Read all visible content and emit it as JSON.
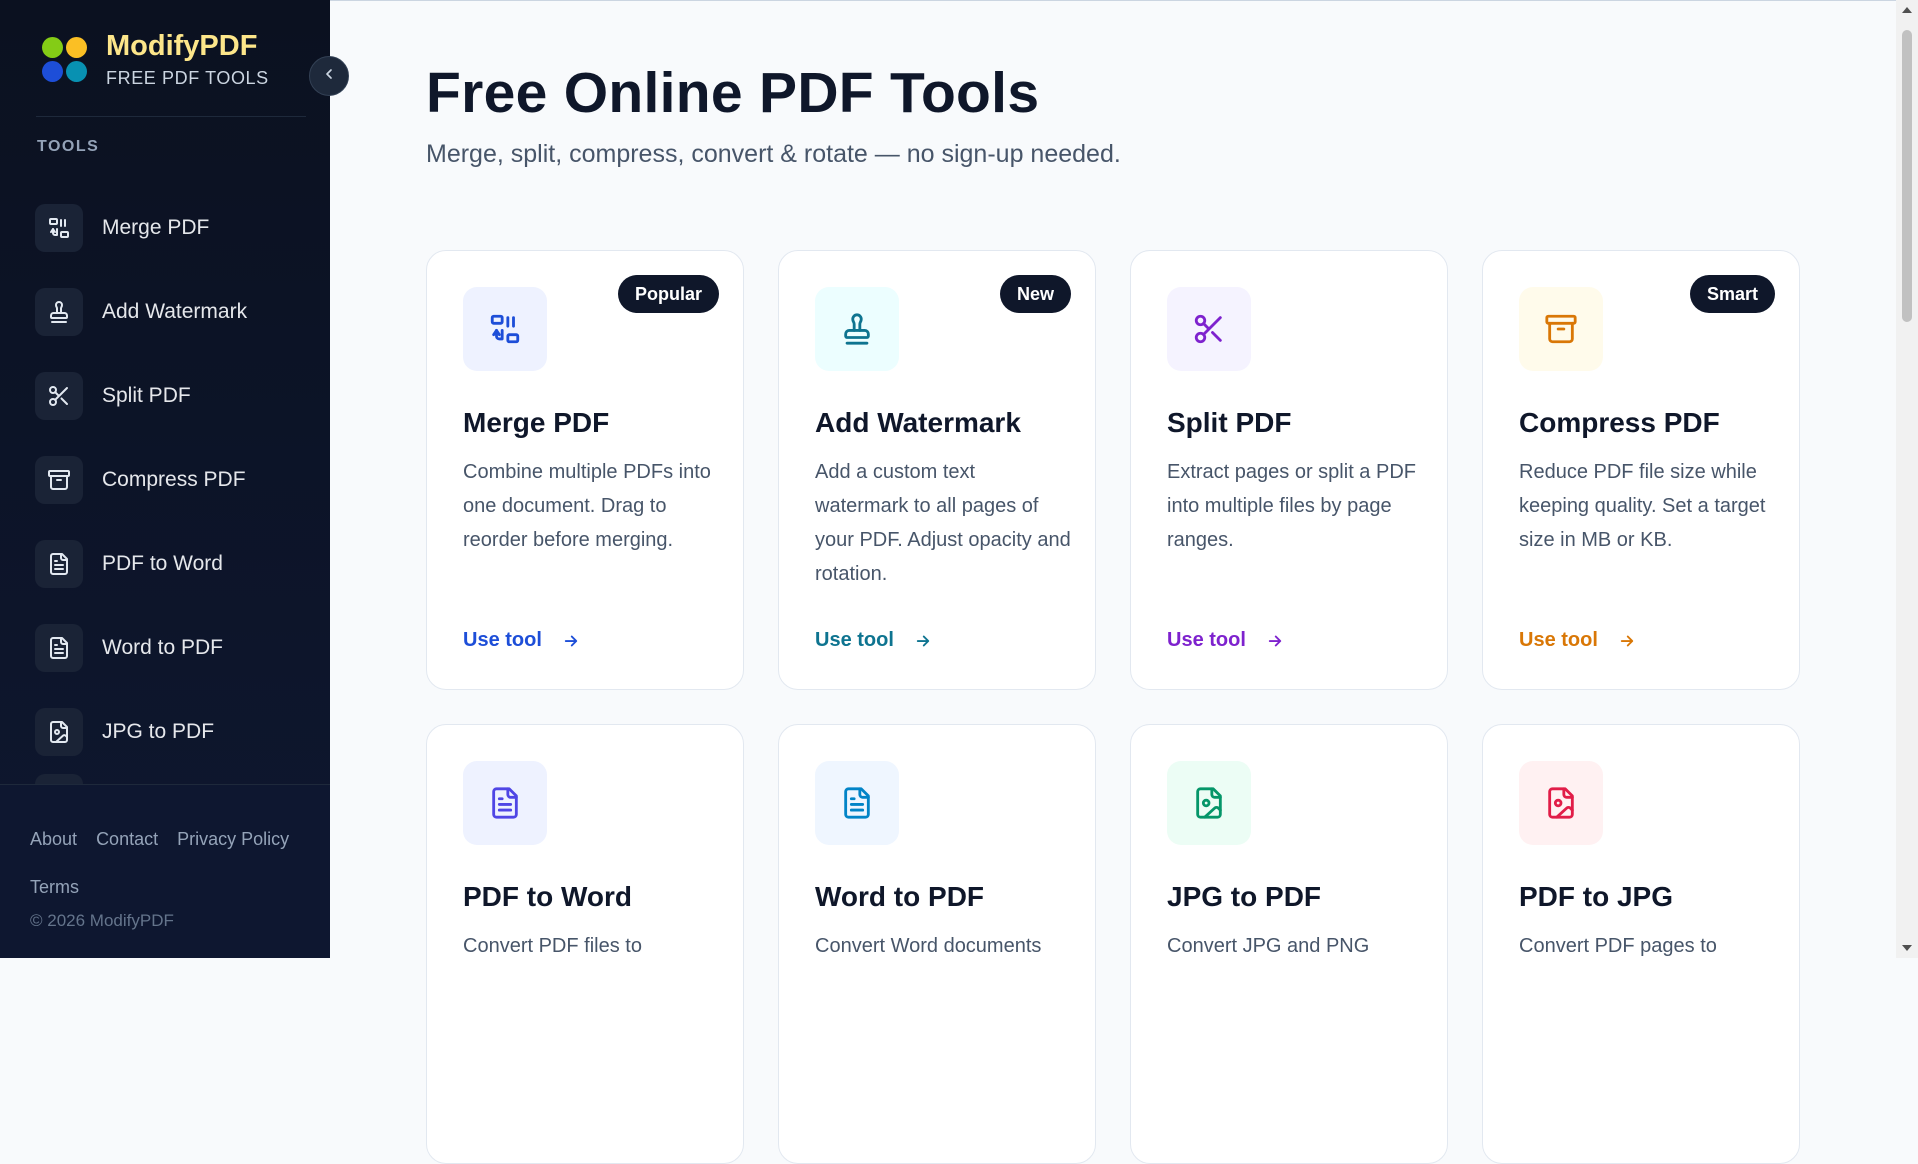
{
  "brand": {
    "name": "ModifyPDF",
    "tagline": "FREE PDF TOOLS",
    "logo_colors": [
      "#84cc16",
      "#fbbf24",
      "#1d4ed8",
      "#0891b2"
    ]
  },
  "sidebar": {
    "section_label": "TOOLS",
    "items": [
      {
        "label": "Merge PDF",
        "icon": "merge-icon"
      },
      {
        "label": "Add Watermark",
        "icon": "stamp-icon"
      },
      {
        "label": "Split PDF",
        "icon": "scissors-icon"
      },
      {
        "label": "Compress PDF",
        "icon": "archive-icon"
      },
      {
        "label": "PDF to Word",
        "icon": "file-text-icon"
      },
      {
        "label": "Word to PDF",
        "icon": "file-text-icon"
      },
      {
        "label": "JPG to PDF",
        "icon": "file-image-icon"
      }
    ],
    "footer": {
      "links": [
        "About",
        "Contact",
        "Privacy Policy",
        "Terms"
      ],
      "copyright": "© 2026 ModifyPDF"
    }
  },
  "main": {
    "title": "Free Online PDF Tools",
    "subtitle": "Merge, split, compress, convert & rotate — no sign-up needed.",
    "cards": [
      {
        "title": "Merge PDF",
        "desc": "Combine multiple PDFs into one document. Drag to reorder before merging.",
        "badge": "Popular",
        "link": "Use tool",
        "icon": "merge-icon",
        "accent": "#1d4ed8",
        "icon_bg": "#eef2ff"
      },
      {
        "title": "Add Watermark",
        "desc": "Add a custom text watermark to all pages of your PDF. Adjust opacity and rotation.",
        "badge": "New",
        "link": "Use tool",
        "icon": "stamp-icon",
        "accent": "#0e7490",
        "icon_bg": "#ecfeff"
      },
      {
        "title": "Split PDF",
        "desc": "Extract pages or split a PDF into multiple files by page ranges.",
        "badge": "",
        "link": "Use tool",
        "icon": "scissors-icon",
        "accent": "#7e22ce",
        "icon_bg": "#f5f3ff"
      },
      {
        "title": "Compress PDF",
        "desc": "Reduce PDF file size while keeping quality. Set a target size in MB or KB.",
        "badge": "Smart",
        "link": "Use tool",
        "icon": "archive-icon",
        "accent": "#d97706",
        "icon_bg": "#fffbeb"
      },
      {
        "title": "PDF to Word",
        "desc": "Convert PDF files to",
        "badge": "",
        "link": "",
        "icon": "file-text-icon",
        "accent": "#4f46e5",
        "icon_bg": "#eef2ff"
      },
      {
        "title": "Word to PDF",
        "desc": "Convert Word documents",
        "badge": "",
        "link": "",
        "icon": "file-text-icon",
        "accent": "#0284c7",
        "icon_bg": "#eff6ff"
      },
      {
        "title": "JPG to PDF",
        "desc": "Convert JPG and PNG",
        "badge": "",
        "link": "",
        "icon": "file-image-icon",
        "accent": "#059669",
        "icon_bg": "#ecfdf5"
      },
      {
        "title": "PDF to JPG",
        "desc": "Convert PDF pages to",
        "badge": "",
        "link": "",
        "icon": "file-image-icon",
        "accent": "#e11d48",
        "icon_bg": "#fff1f2"
      }
    ]
  }
}
